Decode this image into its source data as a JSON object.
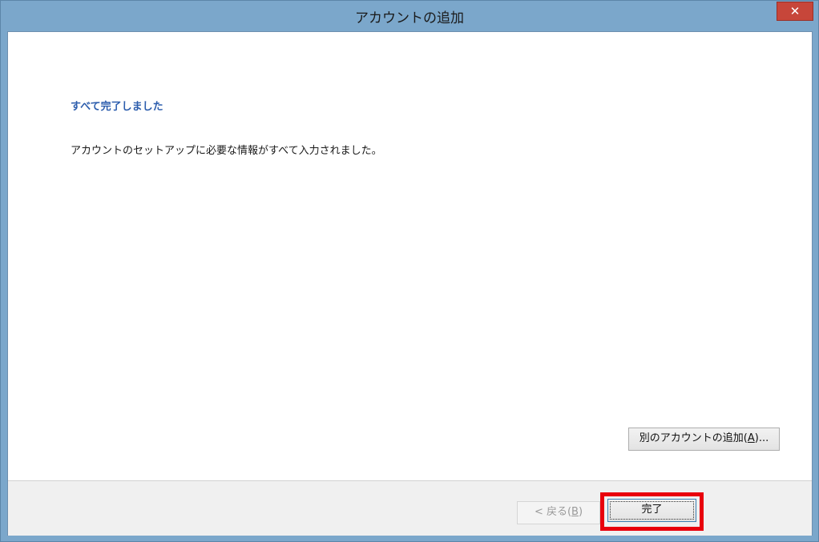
{
  "window": {
    "title": "アカウントの追加",
    "close_symbol": "✕"
  },
  "content": {
    "heading": "すべて完了しました",
    "message": "アカウントのセットアップに必要な情報がすべて入力されました。"
  },
  "buttons": {
    "add_account_prefix": "別のアカウントの追加(",
    "add_account_key": "A",
    "add_account_suffix": ")...",
    "back_prefix": "< 戻る(",
    "back_key": "B",
    "back_suffix": ")",
    "finish": "完了"
  },
  "colors": {
    "heading": "#2c5dad",
    "highlight": "#e8000d",
    "title_bar": "#7ba7cb"
  }
}
